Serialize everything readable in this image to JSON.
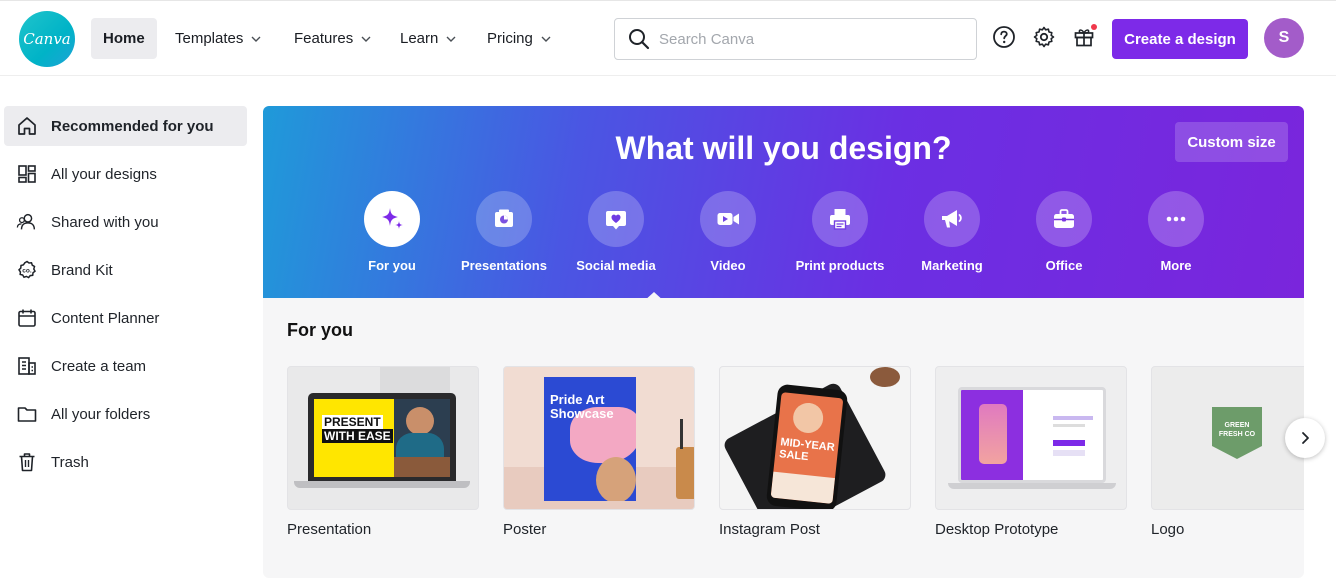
{
  "logo": {
    "text": "Canva"
  },
  "nav": [
    {
      "label": "Home"
    },
    {
      "label": "Templates"
    },
    {
      "label": "Features"
    },
    {
      "label": "Learn"
    },
    {
      "label": "Pricing"
    }
  ],
  "search": {
    "placeholder": "Search Canva",
    "value": ""
  },
  "header": {
    "create_label": "Create a design",
    "avatar_initial": "S"
  },
  "sidebar": {
    "items": [
      {
        "label": "Recommended for you",
        "icon": "home-icon"
      },
      {
        "label": "All your designs",
        "icon": "grid-icon"
      },
      {
        "label": "Shared with you",
        "icon": "people-icon"
      },
      {
        "label": "Brand Kit",
        "icon": "brand-kit-icon"
      },
      {
        "label": "Content Planner",
        "icon": "calendar-icon"
      },
      {
        "label": "Create a team",
        "icon": "building-icon"
      },
      {
        "label": "All your folders",
        "icon": "folder-icon"
      },
      {
        "label": "Trash",
        "icon": "trash-icon"
      }
    ]
  },
  "hero": {
    "title": "What will you design?",
    "custom_size": "Custom size",
    "categories": [
      {
        "label": "For you",
        "icon": "sparkle-icon"
      },
      {
        "label": "Presentations",
        "icon": "presentation-icon"
      },
      {
        "label": "Social media",
        "icon": "heart-chat-icon"
      },
      {
        "label": "Video",
        "icon": "video-camera-icon"
      },
      {
        "label": "Print products",
        "icon": "printer-icon"
      },
      {
        "label": "Marketing",
        "icon": "megaphone-icon"
      },
      {
        "label": "Office",
        "icon": "briefcase-icon"
      },
      {
        "label": "More",
        "icon": "more-dots-icon"
      }
    ]
  },
  "for_you": {
    "title": "For you",
    "cards": [
      {
        "label": "Presentation",
        "thumb_text": [
          "PRESENT",
          "WITH EASE"
        ]
      },
      {
        "label": "Poster",
        "thumb_text": [
          "Pride Art",
          "Showcase"
        ]
      },
      {
        "label": "Instagram Post",
        "thumb_text": [
          "MID-YEAR",
          "SALE"
        ]
      },
      {
        "label": "Desktop Prototype"
      },
      {
        "label": "Logo",
        "thumb_text": [
          "GREEN",
          "FRESH CO"
        ]
      }
    ]
  },
  "colors": {
    "brand_purple": "#7d2ae8",
    "canva_teal": "#00c4cc",
    "avatar": "#a35cc9"
  }
}
